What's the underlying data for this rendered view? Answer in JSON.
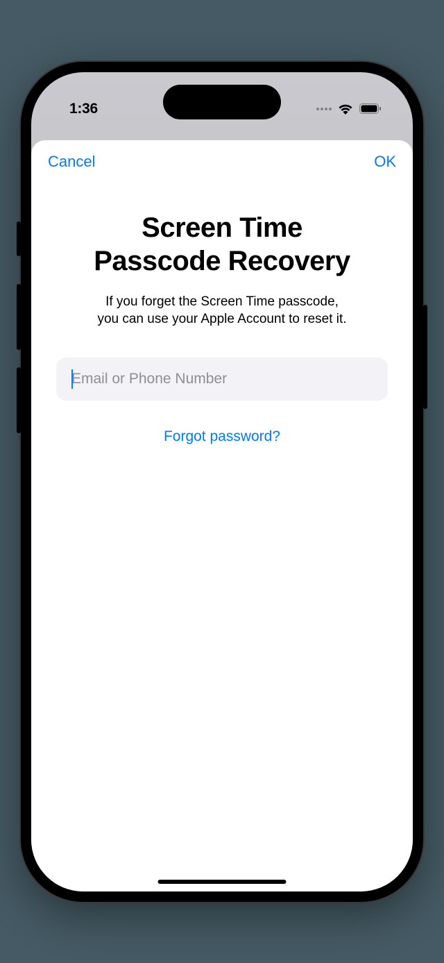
{
  "status": {
    "time": "1:36"
  },
  "sheet": {
    "cancel_label": "Cancel",
    "ok_label": "OK"
  },
  "main": {
    "title_line1": "Screen Time",
    "title_line2": "Passcode Recovery",
    "subtitle_line1": "If you forget the Screen Time passcode,",
    "subtitle_line2": "you can use your Apple Account to reset it.",
    "input_placeholder": "Email or Phone Number",
    "input_value": "",
    "forgot_label": "Forgot password?"
  },
  "colors": {
    "accent": "#007aff",
    "input_bg": "#f2f2f7",
    "placeholder": "#8e8e93"
  }
}
